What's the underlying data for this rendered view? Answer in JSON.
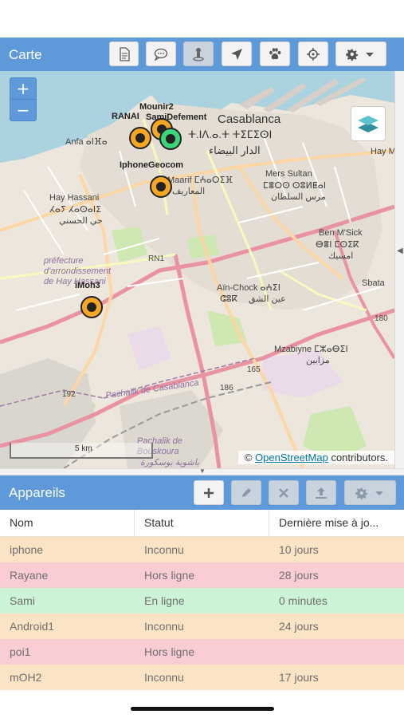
{
  "map_panel": {
    "title": "Carte",
    "toolbar": [
      "document-icon",
      "chat-icon",
      "person-pin-icon",
      "navigation-arrow-icon",
      "paw-icon",
      "crosshair-icon",
      "settings-dropdown-icon"
    ],
    "zoom_in": "+",
    "zoom_out": "−",
    "markers": [
      {
        "label": "Mounir2",
        "color": "#f5a623"
      },
      {
        "label": "RANAI",
        "color": "#f5a623"
      },
      {
        "label": "SamiDefement",
        "color": "#3cd67a"
      },
      {
        "label": "IphoneGeocom",
        "color": "#f5a623"
      },
      {
        "label": "iMoh3",
        "color": "#f5a623"
      }
    ],
    "places": [
      {
        "name": "Casablanca"
      },
      {
        "name": "ⵜ.ⵏⴷ.ⴰ.ⵜ ⵜⵉⵎⵉⵙⵏ"
      },
      {
        "name": "الدار البيضاء"
      },
      {
        "name": "Anfa ⴰⵏⴼⴰ"
      },
      {
        "name": "Hay Hassani"
      },
      {
        "name": "ⵃⴰⵢ ⵃⴰⵙⴰⵏⵉ"
      },
      {
        "name": "حي الحسني"
      },
      {
        "name": "Maarif ⵎⵄⴰⵔⵉⴼ"
      },
      {
        "name": "المعاريف"
      },
      {
        "name": "Mers Sultan"
      },
      {
        "name": "ⵎⴻⵔⵙ ⵙⵓⵍⵟⴰⵏ"
      },
      {
        "name": "مرس السلطان"
      },
      {
        "name": "Ben M'Sick"
      },
      {
        "name": "ⴱⴻⵏ ⵎⵙⵉⴽ"
      },
      {
        "name": "امسيك"
      },
      {
        "name": "Aïn-Chock ⴰⵄⵉⵏ"
      },
      {
        "name": "ⵛⵓⴽ"
      },
      {
        "name": "عين الشق"
      },
      {
        "name": "Mzabiyne ⵎⵣⴰⴱⵉⵏ"
      },
      {
        "name": "مزابين"
      },
      {
        "name": "Sbata"
      },
      {
        "name": "Hay M"
      },
      {
        "name": "préfecture d'arrondissement de Hay Hassani"
      },
      {
        "name": "Pachalik de Casablanca"
      },
      {
        "name": "Pachalik de Bouskoura"
      },
      {
        "name": "باشوية بوسكورة"
      },
      {
        "name": "RN1"
      },
      {
        "name": "165"
      },
      {
        "name": "186"
      },
      {
        "name": "192"
      },
      {
        "name": "180"
      }
    ],
    "scale": "5 km",
    "attribution_prefix": "©",
    "attribution_link": "OpenStreetMap",
    "attribution_suffix": "contributors."
  },
  "devices_panel": {
    "title": "Appareils",
    "toolbar": [
      "add-icon",
      "edit-icon",
      "delete-icon",
      "upload-icon",
      "settings-dropdown-icon"
    ],
    "columns": [
      "Nom",
      "Statut",
      "Dernière mise à jo..."
    ],
    "rows": [
      {
        "name": "iphone",
        "status": "Inconnu",
        "last": "10 jours",
        "color": "#fbe3c6"
      },
      {
        "name": "Rayane",
        "status": "Hors ligne",
        "last": "28 jours",
        "color": "#f9cdd3"
      },
      {
        "name": "Sami",
        "status": "En ligne",
        "last": "0 minutes",
        "color": "#cdf3d6"
      },
      {
        "name": "Android1",
        "status": "Inconnu",
        "last": "24 jours",
        "color": "#fbe3c6"
      },
      {
        "name": "poi1",
        "status": "Hors ligne",
        "last": "",
        "color": "#f9cdd3"
      },
      {
        "name": "mOH2",
        "status": "Inconnu",
        "last": "17 jours",
        "color": "#fbe3c6"
      }
    ]
  }
}
